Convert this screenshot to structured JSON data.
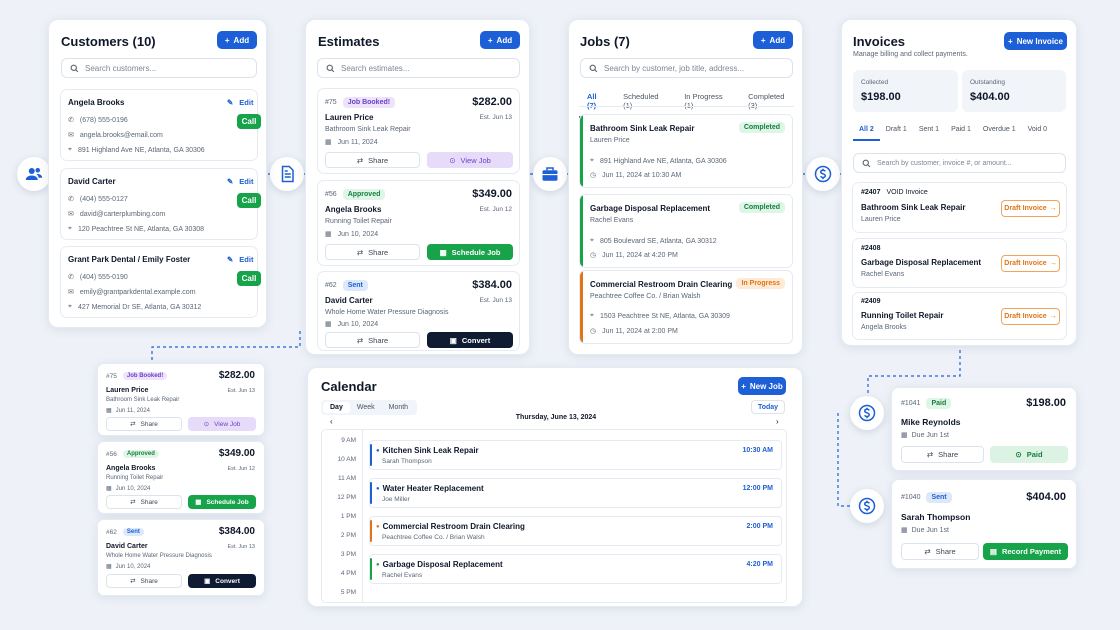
{
  "colors": {
    "primary": "#1d5fd6",
    "success": "#16a34a",
    "dark": "#0f1b33",
    "warning": "#e07515",
    "purple": "#6d3fc8"
  },
  "customers": {
    "title": "Customers (10)",
    "add": "Add",
    "search_placeholder": "Search customers...",
    "items": [
      {
        "name": "Angela Brooks",
        "phone": "(678) 555-0196",
        "email": "angela.brooks@email.com",
        "address": "891 Highland Ave NE, Atlanta, GA 30306",
        "edit": "Edit",
        "call": "Call"
      },
      {
        "name": "David Carter",
        "phone": "(404) 555-0127",
        "email": "david@carterplumbing.com",
        "address": "120 Peachtree St NE, Atlanta, GA 30308",
        "edit": "Edit",
        "call": "Call"
      },
      {
        "name": "Grant Park Dental / Emily Foster",
        "phone": "(404) 555-0190",
        "email": "emily@grantparkdental.example.com",
        "address": "427 Memorial Dr SE, Atlanta, GA 30312",
        "edit": "Edit",
        "call": "Call"
      }
    ]
  },
  "estimates": {
    "title": "Estimates",
    "add": "Add",
    "search_placeholder": "Search estimates...",
    "items": [
      {
        "num": "#75",
        "status": "Job Booked!",
        "amount": "$282.00",
        "name": "Lauren Price",
        "est": "Est. Jun 13",
        "job": "Bathroom Sink Leak Repair",
        "date": "Jun 11, 2024",
        "share": "Share",
        "action": "View Job"
      },
      {
        "num": "#56",
        "status": "Approved",
        "amount": "$349.00",
        "name": "Angela Brooks",
        "est": "Est. Jun 12",
        "job": "Running Toilet Repair",
        "date": "Jun 10, 2024",
        "share": "Share",
        "action": "Schedule Job"
      },
      {
        "num": "#62",
        "status": "Sent",
        "amount": "$384.00",
        "name": "David Carter",
        "est": "Est. Jun 13",
        "job": "Whole Home Water Pressure Diagnosis",
        "date": "Jun 10, 2024",
        "share": "Share",
        "action": "Convert"
      }
    ]
  },
  "jobs": {
    "title": "Jobs (7)",
    "add": "Add",
    "search_placeholder": "Search by customer, job title, address...",
    "tabs": [
      "All (7)",
      "Scheduled (1)",
      "In Progress (1)",
      "Completed (3)"
    ],
    "items": [
      {
        "title": "Bathroom Sink Leak Repair",
        "customer": "Lauren Price",
        "status": "Completed",
        "address": "891 Highland Ave NE, Atlanta, GA 30306",
        "time": "Jun 11, 2024 at 10:30 AM"
      },
      {
        "title": "Garbage Disposal Replacement",
        "customer": "Rachel Evans",
        "status": "Completed",
        "address": "805 Boulevard SE, Atlanta, GA 30312",
        "time": "Jun 11, 2024 at 4:20 PM"
      },
      {
        "title": "Commercial Restroom Drain Clearing",
        "customer": "Peachtree Coffee Co. / Brian Walsh",
        "status": "In Progress",
        "address": "1503 Peachtree St NE, Atlanta, GA 30309",
        "time": "Jun 11, 2024 at 2:00 PM"
      }
    ]
  },
  "invoices": {
    "title": "Invoices",
    "subtitle": "Manage billing and collect payments.",
    "new": "New Invoice",
    "collected_label": "Collected",
    "collected": "$198.00",
    "outstanding_label": "Outstanding",
    "outstanding": "$404.00",
    "tabs": [
      "All 2",
      "Draft 1",
      "Sent 1",
      "Paid 1",
      "Overdue 1",
      "Void 0"
    ],
    "search_placeholder": "Search by customer, invoice #, or amount...",
    "items": [
      {
        "num": "#2407",
        "tag": "VOID Invoice",
        "job": "Bathroom Sink Leak Repair",
        "customer": "Lauren Price",
        "action": "Draft Invoice"
      },
      {
        "num": "#2408",
        "tag": "",
        "job": "Garbage Disposal Replacement",
        "customer": "Rachel Evans",
        "action": "Draft Invoice"
      },
      {
        "num": "#2409",
        "tag": "",
        "job": "Running Toilet Repair",
        "customer": "Angela Brooks",
        "action": "Draft Invoice"
      }
    ]
  },
  "mini_estimates": [
    {
      "num": "#75",
      "status": "Job Booked!",
      "amount": "$282.00",
      "name": "Lauren Price",
      "est": "Est. Jun 13",
      "job": "Bathroom Sink Leak Repair",
      "date": "Jun 11, 2024",
      "share": "Share",
      "action": "View Job"
    },
    {
      "num": "#56",
      "status": "Approved",
      "amount": "$349.00",
      "name": "Angela Brooks",
      "est": "Est. Jun 12",
      "job": "Running Toilet Repair",
      "date": "Jun 10, 2024",
      "share": "Share",
      "action": "Schedule Job"
    },
    {
      "num": "#62",
      "status": "Sent",
      "amount": "$384.00",
      "name": "David Carter",
      "est": "Est. Jun 13",
      "job": "Whole Home Water Pressure Diagnosis",
      "date": "Jun 10, 2024",
      "share": "Share",
      "action": "Convert"
    }
  ],
  "calendar": {
    "title": "Calendar",
    "new": "New Job",
    "views": [
      "Day",
      "Week",
      "Month"
    ],
    "today": "Today",
    "date": "Thursday, June 13, 2024",
    "hours": [
      "9 AM",
      "10 AM",
      "11 AM",
      "12 PM",
      "1 PM",
      "2 PM",
      "3 PM",
      "4 PM",
      "5 PM"
    ],
    "events": [
      {
        "title": "Kitchen Sink Leak Repair",
        "customer": "Sarah Thompson",
        "time": "10:30 AM",
        "color": "#1d5fd6"
      },
      {
        "title": "Water Heater Replacement",
        "customer": "Joe Miller",
        "time": "12:00 PM",
        "color": "#1d5fd6"
      },
      {
        "title": "Commercial Restroom Drain Clearing",
        "customer": "Peachtree Coffee Co. / Brian Walsh",
        "time": "2:00 PM",
        "color": "#e07515"
      },
      {
        "title": "Garbage Disposal Replacement",
        "customer": "Rachel Evans",
        "time": "4:20 PM",
        "color": "#16a34a"
      }
    ]
  },
  "payments": [
    {
      "num": "#1041",
      "status": "Paid",
      "amount": "$198.00",
      "name": "Mike Reynolds",
      "due": "Due Jun 1st",
      "share": "Share",
      "action": "Paid"
    },
    {
      "num": "#1040",
      "status": "Sent",
      "amount": "$404.00",
      "name": "Sarah Thompson",
      "due": "Due Jun 1st",
      "share": "Share",
      "action": "Record Payment"
    }
  ]
}
